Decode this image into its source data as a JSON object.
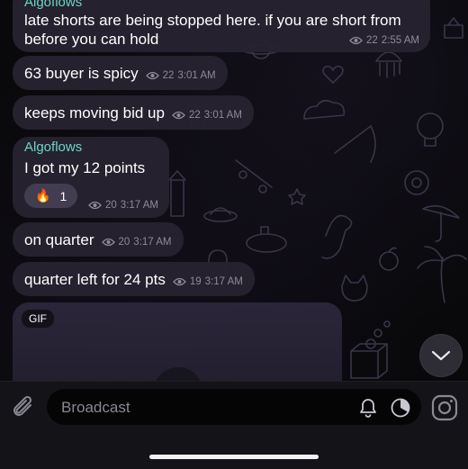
{
  "messages": [
    {
      "sender": "Algoflows",
      "text": "late shorts are being stopped here. if you are short from before you can hold",
      "views": "22",
      "time": "2:55 AM"
    },
    {
      "text": "63 buyer is spicy",
      "views": "22",
      "time": "3:01 AM"
    },
    {
      "text": "keeps moving bid up",
      "views": "22",
      "time": "3:01 AM"
    },
    {
      "sender": "Algoflows",
      "text": "I got my 12 points",
      "reaction_emoji": "🔥",
      "reaction_count": "1",
      "views": "20",
      "time": "3:17 AM"
    },
    {
      "text": "on quarter",
      "views": "20",
      "time": "3:17 AM"
    },
    {
      "text": "quarter left for 24 pts",
      "views": "19",
      "time": "3:17 AM"
    }
  ],
  "gif": {
    "badge": "GIF"
  },
  "composer": {
    "placeholder": "Broadcast"
  },
  "icons": {
    "attach": "paperclip-icon",
    "notify": "bell-icon",
    "timer": "timer-icon",
    "camera": "instagram-camera-icon",
    "scroll": "chevron-down-icon",
    "views": "eye-icon"
  },
  "colors": {
    "sender": "#6bd6c6",
    "bubble": "#26222f",
    "meta": "#8e8b97",
    "background": "#09090b"
  }
}
